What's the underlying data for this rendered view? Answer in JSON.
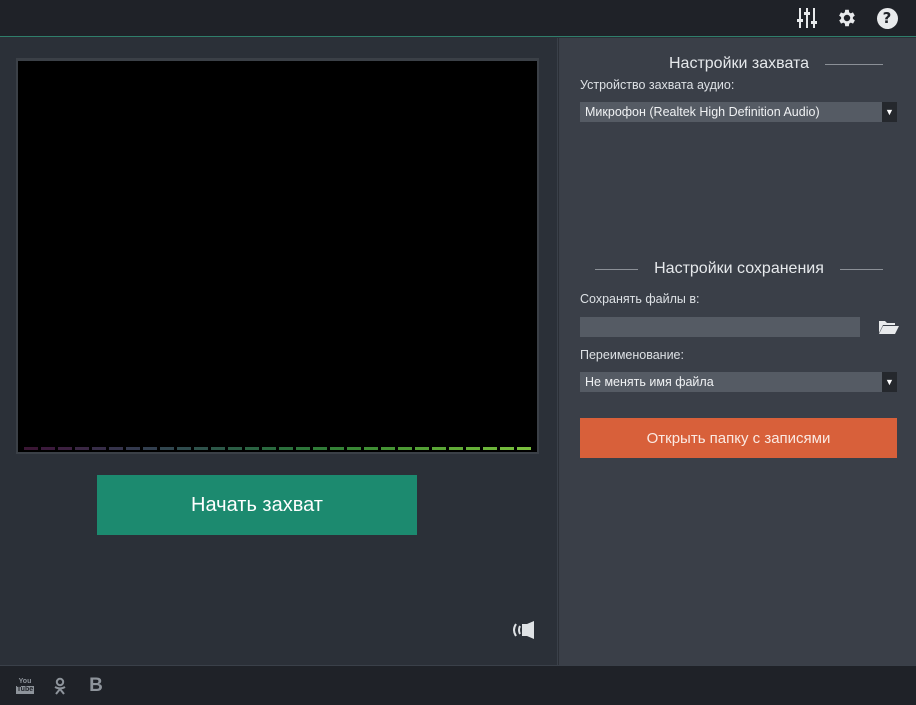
{
  "toolbar": {
    "icons": [
      "mixer-icon",
      "gear-icon",
      "help-icon"
    ],
    "help_glyph": "?"
  },
  "capture": {
    "start_label": "Начать захват",
    "meter_colors": [
      "#3a1634",
      "#3b1a3c",
      "#3c2040",
      "#3a2744",
      "#372d48",
      "#35334b",
      "#33394e",
      "#323f4f",
      "#31464f",
      "#2f4c4e",
      "#2e524b",
      "#2c5848",
      "#2b5e45",
      "#2a6442",
      "#2a6a3f",
      "#2b703c",
      "#2d763a",
      "#307c38",
      "#348236",
      "#398835",
      "#3f8e34",
      "#459434",
      "#4c9a34",
      "#53a035",
      "#5aa636",
      "#60ab37",
      "#66b038",
      "#6cb53a",
      "#73ba3c",
      "#7abf3e"
    ]
  },
  "settings": {
    "capture_title": "Настройки захвата",
    "audio_device_label": "Устройство захвата аудио:",
    "audio_device_value": "Микрофон (Realtek High Definition Audio)",
    "save_title": "Настройки сохранения",
    "save_path_label": "Сохранять файлы в:",
    "save_path_value": "",
    "rename_label": "Переименование:",
    "rename_value": "Не менять имя файла",
    "open_folder_label": "Открыть папку с записями"
  },
  "footer": {
    "youtube_top": "You",
    "youtube_bottom": "Tube",
    "vk_glyph": "B"
  },
  "colors": {
    "accent_green": "#1c8a6f",
    "accent_orange": "#d8603a",
    "panel_dark": "#2b3038",
    "panel_light": "#3a3f48"
  }
}
